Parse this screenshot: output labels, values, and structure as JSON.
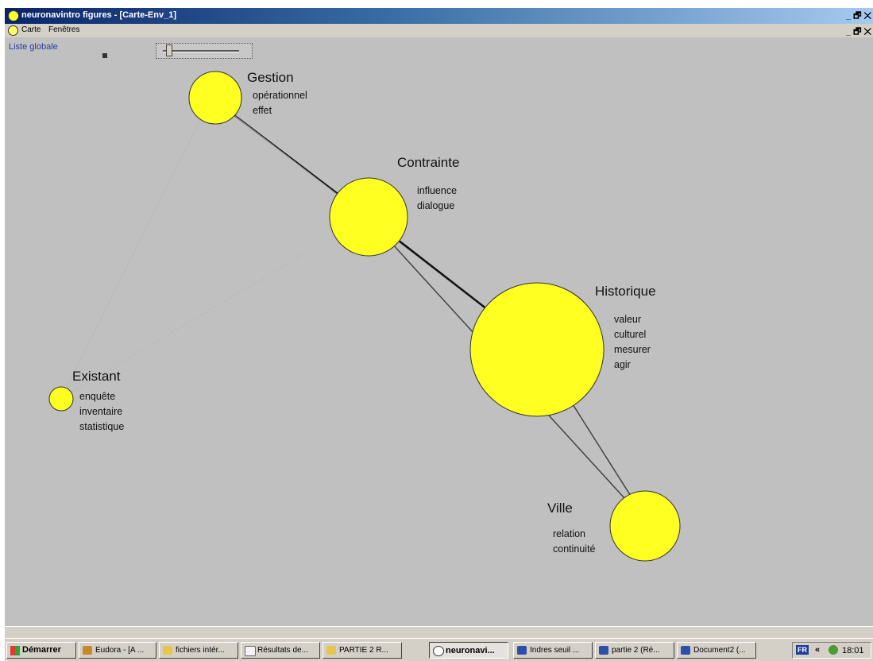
{
  "window": {
    "title": "neuronavintro figures - [Carte-Env_1]",
    "controls": "_ 🗗 ✕"
  },
  "menubar": {
    "items": [
      "Carte",
      "Fenêtres"
    ],
    "doc_controls": "_ 🗗 ✕"
  },
  "toolbar": {
    "list_link": "Liste globale",
    "slider_level": 0.05
  },
  "map": {
    "node_color": "#ffff22",
    "nodes": [
      {
        "id": "gestion",
        "title": "Gestion",
        "terms": [
          "opérationnel",
          "effet"
        ]
      },
      {
        "id": "contrainte",
        "title": "Contrainte",
        "terms": [
          "influence",
          "dialogue"
        ]
      },
      {
        "id": "historique",
        "title": "Historique",
        "terms": [
          "valeur",
          "culturel",
          "mesurer",
          "agir"
        ]
      },
      {
        "id": "existant",
        "title": "Existant",
        "terms": [
          "enquête",
          "inventaire",
          "statistique"
        ]
      },
      {
        "id": "ville",
        "title": "Ville",
        "terms": [
          "relation",
          "continuité"
        ]
      }
    ],
    "links": [
      {
        "from": "gestion",
        "to": "contrainte",
        "strength": "strong"
      },
      {
        "from": "gestion",
        "to": "historique",
        "strength": "faint"
      },
      {
        "from": "contrainte",
        "to": "historique",
        "strength": "strong"
      },
      {
        "from": "contrainte",
        "to": "ville",
        "strength": "medium"
      },
      {
        "from": "historique",
        "to": "ville",
        "strength": "medium"
      },
      {
        "from": "gestion",
        "to": "existant",
        "strength": "faint"
      }
    ]
  },
  "taskbar": {
    "start": "Démarrer",
    "tasks": [
      {
        "label": "Eudora - [A ...",
        "icon": "eudora-icon"
      },
      {
        "label": "fichiers intér...",
        "icon": "folder-icon"
      },
      {
        "label": "Résultats de...",
        "icon": "document-icon"
      },
      {
        "label": "PARTIE 2 R...",
        "icon": "folder-icon"
      },
      {
        "label": "neuronavi...",
        "icon": "neuronav-icon",
        "active": true
      },
      {
        "label": "Indres seuil ...",
        "icon": "word-icon"
      },
      {
        "label": "partie 2 (Ré...",
        "icon": "word-icon"
      },
      {
        "label": "Document2 (...",
        "icon": "word-icon"
      }
    ],
    "language": "FR",
    "chevron": "«",
    "clock": "18:01"
  }
}
